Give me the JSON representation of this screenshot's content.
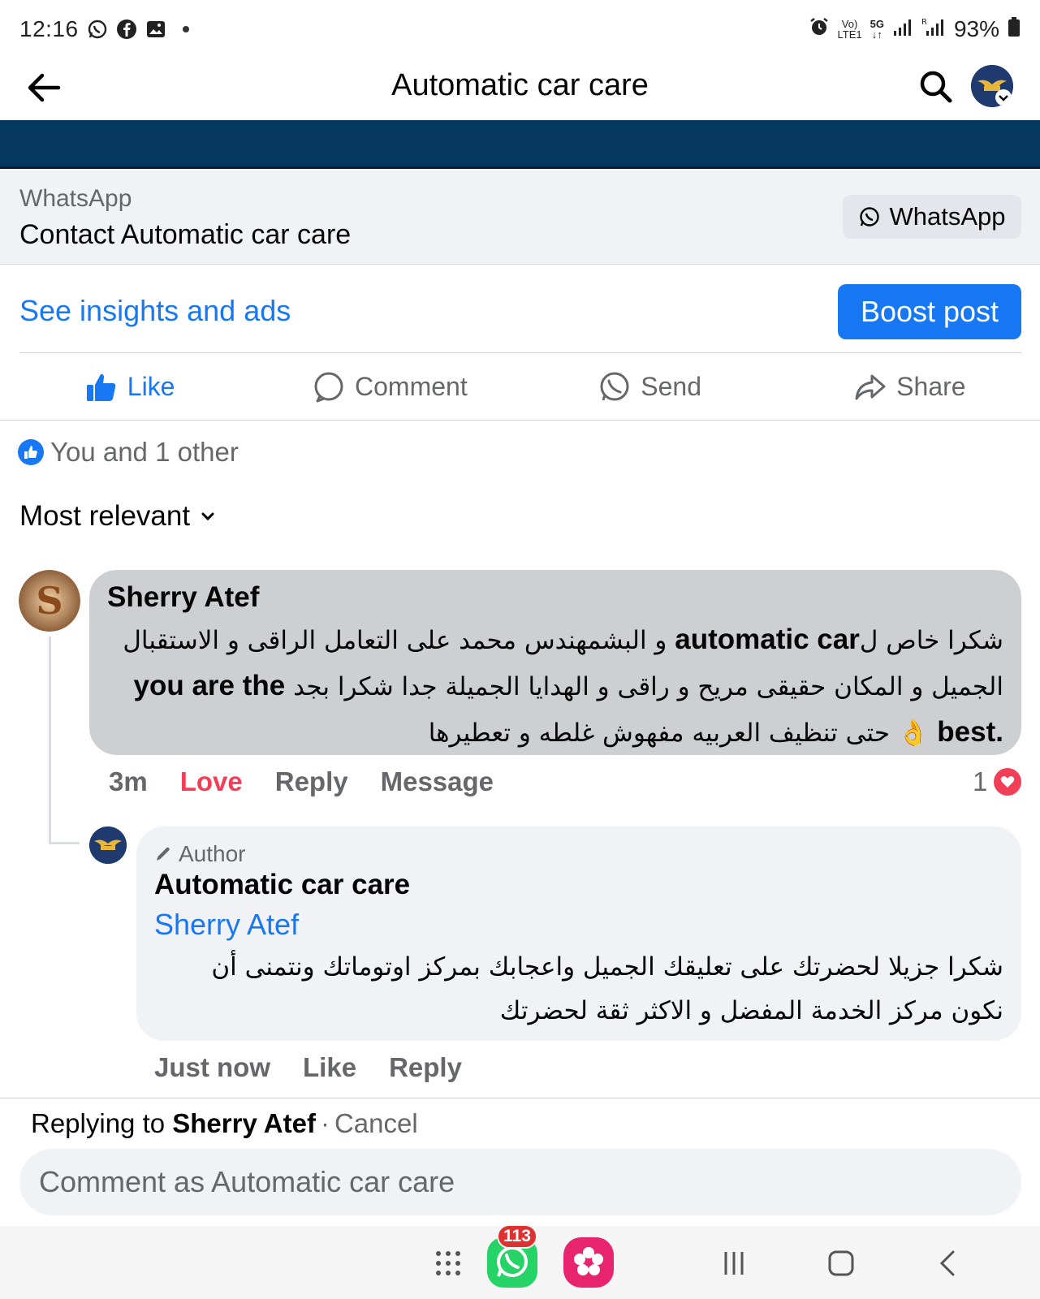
{
  "status_bar": {
    "time": "12:16",
    "battery": "93%",
    "left_icons": [
      "whatsapp-icon",
      "facebook-icon",
      "gallery-icon"
    ],
    "right_icons": [
      "alarm-icon",
      "volte-icon",
      "5g-icon",
      "signal-icon",
      "signal-roaming-icon",
      "battery-icon"
    ]
  },
  "header": {
    "title": "Automatic car care"
  },
  "whatsapp_contact": {
    "label": "WhatsApp",
    "title": "Contact Automatic car care",
    "button_label": "WhatsApp"
  },
  "insights": {
    "link_label": "See insights and ads",
    "boost_label": "Boost post"
  },
  "actions": {
    "like": "Like",
    "comment": "Comment",
    "send": "Send",
    "share": "Share"
  },
  "reactions_summary": "You and 1 other",
  "sort_label": "Most relevant",
  "comments": [
    {
      "author": "Sherry Atef",
      "text_parts": [
        "شكرا خاص ل",
        "automatic car",
        " و البشمهندس محمد على التعامل الراقى و الاستقبال الجميل و المكان حقيقى مريح و راقى و الهدايا الجميلة جدا شكرا بجد ",
        "you are the best.",
        " 👌 حتى تنظيف العربيه مفهوش غلطه و تعطيرها"
      ],
      "time": "3m",
      "reaction_label": "Love",
      "reply_label": "Reply",
      "message_label": "Message",
      "reaction_count": "1",
      "reply": {
        "badge": "Author",
        "author": "Automatic car care",
        "mention": "Sherry Atef",
        "text": "شكرا جزيلا لحضرتك على تعليقك الجميل واعجابك بمركز اوتوماتك ونتمنى أن نكون مركز الخدمة المفضل و الاكثر ثقة لحضرتك",
        "time": "Just now",
        "like_label": "Like",
        "reply_label": "Reply"
      }
    }
  ],
  "composer": {
    "replying_prefix": "Replying to ",
    "replying_name": "Sherry Atef",
    "separator": "·",
    "cancel_label": "Cancel",
    "placeholder": "Comment as Automatic car care"
  },
  "navigation": {
    "whatsapp_badge": "113",
    "items": [
      "apps-icon",
      "whatsapp-icon",
      "gallery-icon",
      "recents-icon",
      "home-icon",
      "back-icon"
    ]
  },
  "colors": {
    "accent": "#1877f2",
    "love": "#f33e58",
    "cover": "#04385e"
  }
}
